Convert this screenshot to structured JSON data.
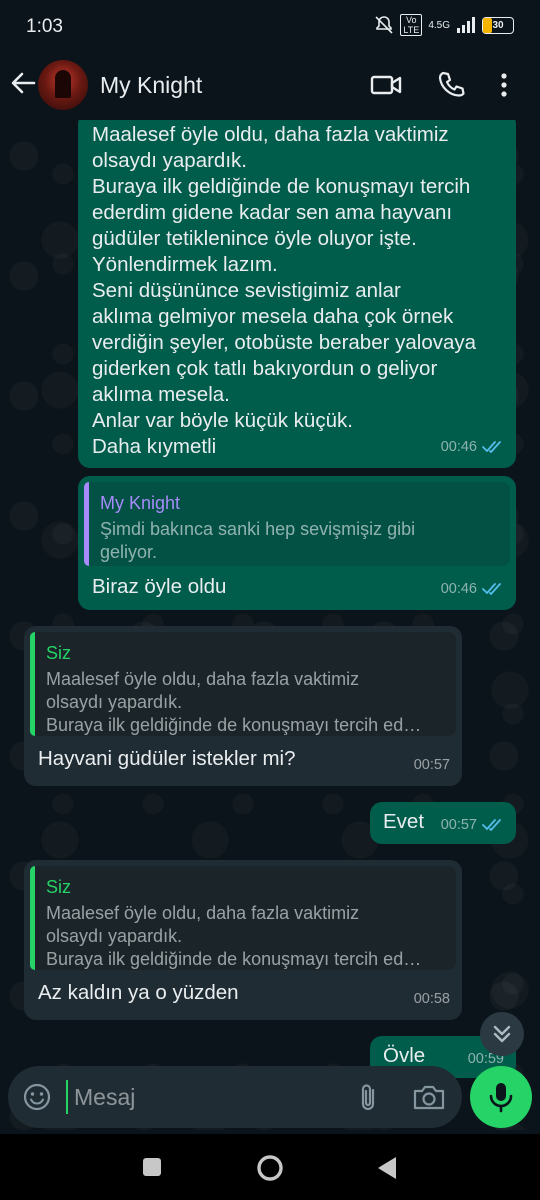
{
  "status_bar": {
    "time": "1:03",
    "network": "4.5G",
    "volte": "Vo LTE",
    "battery": "30"
  },
  "header": {
    "contact_name": "My Knight"
  },
  "messages": [
    {
      "direction": "out",
      "lines": [
        "Maalesef öyle oldu, daha fazla vaktimiz",
        "olsaydı yapardık.",
        "Buraya ilk geldiğinde de konuşmayı tercih",
        "ederdim gidene kadar sen ama hayvanı",
        "güdüler tetiklenince öyle oluyor işte.",
        "Yönlendirmek lazım.",
        "Seni düşününce sevistigimiz anlar",
        "aklıma gelmiyor mesela daha çok örnek",
        "verdiğin şeyler, otobüste beraber yalovaya",
        "giderken çok tatlı bakıyordun o geliyor",
        "aklıma mesela.",
        "Anlar var böyle küçük küçük.",
        "Daha kıymetli"
      ],
      "time": "00:46"
    },
    {
      "direction": "out",
      "quote": {
        "name": "My Knight",
        "lines": [
          "Şimdi bakınca sanki hep sevişmişiz gibi",
          "geliyor."
        ]
      },
      "text": "Biraz öyle oldu",
      "time": "00:46"
    },
    {
      "direction": "in",
      "quote": {
        "name": "Siz",
        "lines": [
          "Maalesef öyle oldu, daha fazla vaktimiz",
          "olsaydı yapardık.",
          "Buraya ilk geldiğinde de konuşmayı tercih ed…"
        ]
      },
      "text": "Hayvani güdüler istekler mi?",
      "time": "00:57"
    },
    {
      "direction": "out",
      "text": "Evet",
      "time": "00:57"
    },
    {
      "direction": "in",
      "quote": {
        "name": "Siz",
        "lines": [
          "Maalesef öyle oldu, daha fazla vaktimiz",
          "olsaydı yapardık.",
          "Buraya ilk geldiğinde de konuşmayı tercih ed…"
        ]
      },
      "text": "Az kaldın ya o yüzden",
      "time": "00:58"
    },
    {
      "direction": "out",
      "text": "Övle",
      "time": "00:59"
    }
  ],
  "composer": {
    "placeholder": "Mesaj"
  },
  "colors": {
    "outgoing": "#005c4b",
    "incoming": "#202c33",
    "accent": "#25d366",
    "read_tick": "#53bdeb",
    "quote_name_contact": "#a78bfa"
  }
}
